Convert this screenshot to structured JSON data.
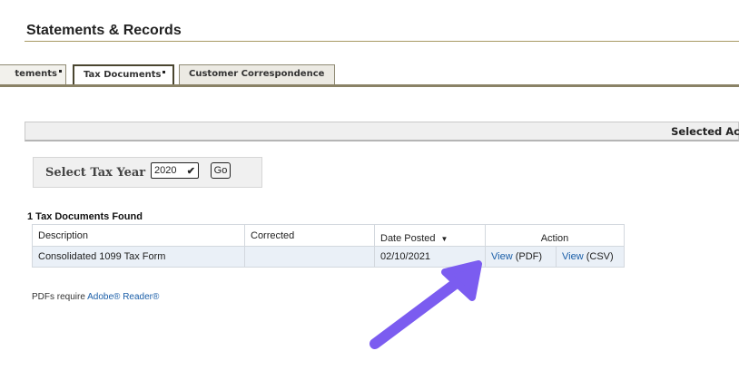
{
  "page": {
    "title": "Statements & Records"
  },
  "tabs": [
    {
      "label": "tements"
    },
    {
      "label": "Tax Documents"
    },
    {
      "label": "Customer Correspondence"
    }
  ],
  "account_bar": {
    "label": "Selected Ac"
  },
  "tax_year": {
    "label": "Select Tax Year",
    "selected": "2020",
    "go_label": "Go"
  },
  "documents": {
    "found_label": "1 Tax Documents Found",
    "columns": [
      "Description",
      "Corrected",
      "Date Posted",
      "Action"
    ],
    "rows": [
      {
        "description": "Consolidated 1099 Tax Form",
        "corrected": "",
        "date_posted": "02/10/2021",
        "view_pdf_link": "View",
        "view_pdf_suffix": "(PDF)",
        "view_csv_link": "View",
        "view_csv_suffix": "(CSV)"
      }
    ]
  },
  "footer_note": {
    "prefix": "PDFs require ",
    "link": "Adobe® Reader®"
  },
  "colors": {
    "link": "#1a5ea8",
    "arrow": "#7b5cf0",
    "tab_rule": "#8a8266"
  }
}
